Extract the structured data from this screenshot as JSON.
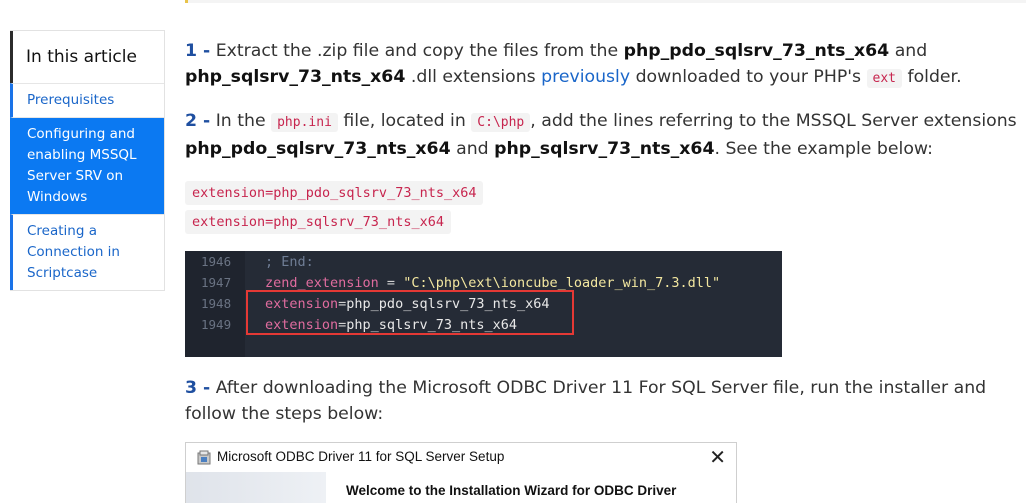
{
  "toc": {
    "title": "In this article",
    "items": [
      {
        "label": "Prerequisites"
      },
      {
        "label": "Configuring and enabling MSSQL Server SRV on Windows"
      },
      {
        "label": "Creating a Connection in Scriptcase"
      }
    ]
  },
  "step1": {
    "num": "1 -",
    "t1": " Extract the .zip file and copy the files from the ",
    "b1": "php_pdo_sqlsrv_73_nts_x64",
    "t2": " and ",
    "b2": "php_sqlsrv_73_nts_x64",
    "t3": " .dll extensions ",
    "link": "previously",
    "t4": " downloaded to your PHP's ",
    "code": "ext",
    "t5": " folder."
  },
  "step2": {
    "num": "2 -",
    "t1": " In the ",
    "code1": "php.ini",
    "t2": " file, located in ",
    "code2": "C:\\php",
    "t3": ", add the lines referring to the MSSQL Server extensions ",
    "b1": "php_pdo_sqlsrv_73_nts_x64",
    "t4": " and ",
    "b2": "php_sqlsrv_73_nts_x64",
    "t5": ". See the example below:"
  },
  "snippets": [
    "extension=php_pdo_sqlsrv_73_nts_x64",
    "extension=php_sqlsrv_73_nts_x64"
  ],
  "editor": {
    "lines": [
      {
        "num": "1946",
        "comment": "; End:"
      },
      {
        "num": "1947",
        "key": "zend_extension",
        "op": " = ",
        "str": "\"C:\\php\\ext\\ioncube_loader_win_7.3.dll\""
      },
      {
        "num": "1948",
        "key": "extension",
        "op": "=",
        "val": "php_pdo_sqlsrv_73_nts_x64"
      },
      {
        "num": "1949",
        "key": "extension",
        "op": "=",
        "val": "php_sqlsrv_73_nts_x64"
      }
    ]
  },
  "step3": {
    "num": "3 -",
    "text": " After downloading the Microsoft ODBC Driver 11 For SQL Server file, run the installer and follow the steps below:"
  },
  "dialog": {
    "title": "Microsoft ODBC Driver 11 for SQL Server Setup",
    "close": "✕",
    "welcome": "Welcome to the Installation Wizard for ODBC Driver"
  }
}
